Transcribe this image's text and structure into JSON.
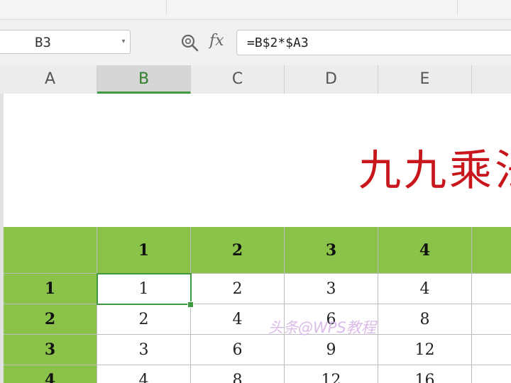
{
  "namebox": {
    "value": "B3"
  },
  "formula": {
    "fx_label": "fx",
    "value": "=B$2*$A3"
  },
  "columns": [
    "A",
    "B",
    "C",
    "D",
    "E"
  ],
  "selected_column": "B",
  "title": "九九乘法",
  "table": {
    "header_row": [
      "",
      "1",
      "2",
      "3",
      "4",
      ""
    ],
    "rows": [
      [
        "1",
        "1",
        "2",
        "3",
        "4",
        ""
      ],
      [
        "2",
        "2",
        "4",
        "6",
        "8",
        ""
      ],
      [
        "3",
        "3",
        "6",
        "9",
        "12",
        ""
      ],
      [
        "4",
        "4",
        "8",
        "12",
        "16",
        ""
      ]
    ]
  },
  "selected_cell": "B3",
  "watermark": "头条@WPS教程",
  "colors": {
    "header_green": "#8bc34a",
    "title_red": "#c8161d",
    "selection": "#3f9a3f"
  }
}
